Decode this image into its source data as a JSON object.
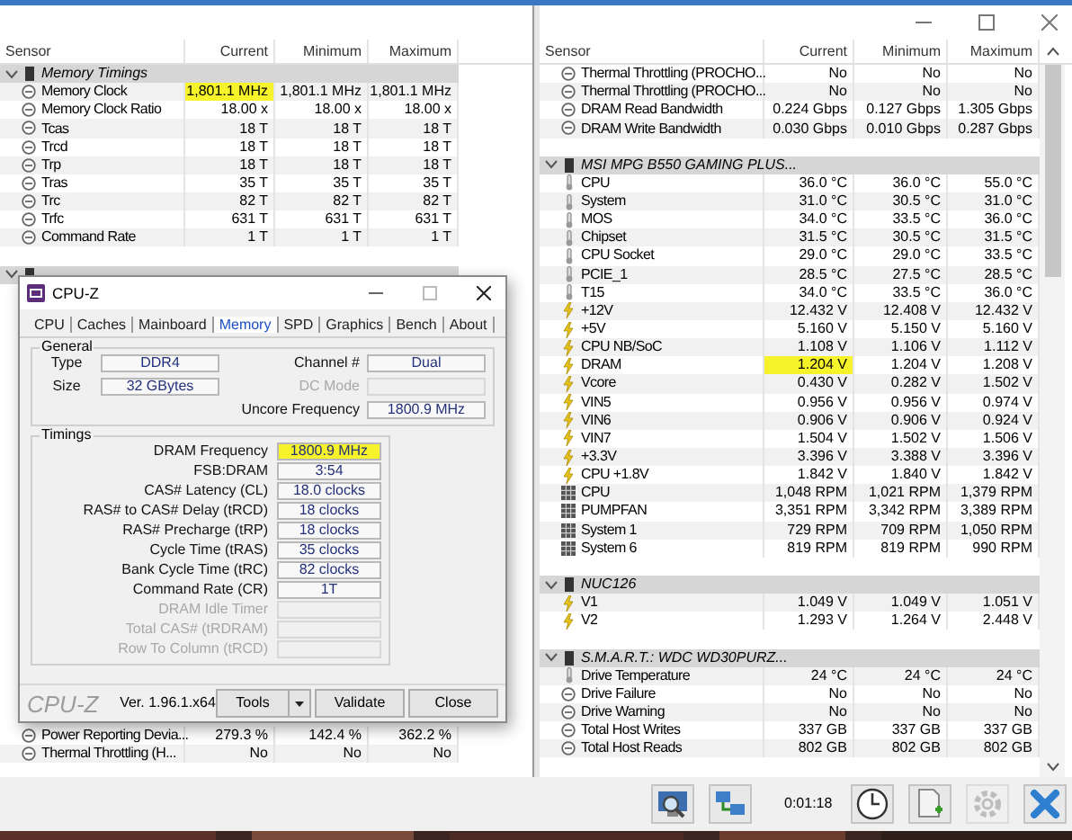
{
  "left_panel": {
    "columns": [
      "Sensor",
      "Current",
      "Minimum",
      "Maximum"
    ],
    "upper_rows": [
      {
        "kind": "group",
        "label": "Memory Timings",
        "expanded": true
      },
      {
        "kind": "status",
        "name": "Memory Clock",
        "current": "1,801.1 MHz",
        "minimum": "1,801.1 MHz",
        "maximum": "1,801.1 MHz",
        "highlighted": true
      },
      {
        "kind": "status",
        "name": "Memory Clock Ratio",
        "current": "18.00 x",
        "minimum": "18.00 x",
        "maximum": "18.00 x",
        "highlighted": false
      },
      {
        "kind": "status",
        "name": "Tcas",
        "current": "18 T",
        "minimum": "18 T",
        "maximum": "18 T",
        "highlighted": false
      },
      {
        "kind": "status",
        "name": "Trcd",
        "current": "18 T",
        "minimum": "18 T",
        "maximum": "18 T",
        "highlighted": false
      },
      {
        "kind": "status",
        "name": "Trp",
        "current": "18 T",
        "minimum": "18 T",
        "maximum": "18 T",
        "highlighted": false
      },
      {
        "kind": "status",
        "name": "Tras",
        "current": "35 T",
        "minimum": "35 T",
        "maximum": "35 T",
        "highlighted": false
      },
      {
        "kind": "status",
        "name": "Trc",
        "current": "82 T",
        "minimum": "82 T",
        "maximum": "82 T",
        "highlighted": false
      },
      {
        "kind": "status",
        "name": "Trfc",
        "current": "631 T",
        "minimum": "631 T",
        "maximum": "631 T",
        "highlighted": false
      },
      {
        "kind": "status",
        "name": "Command Rate",
        "current": "1 T",
        "minimum": "1 T",
        "maximum": "1 T",
        "highlighted": false
      },
      {
        "kind": "spacer"
      },
      {
        "kind": "group",
        "expanded": true
      }
    ],
    "lower_rows": [
      {
        "kind": "status",
        "name": "Power Reporting Devia...",
        "current": "279.3 %",
        "minimum": "142.4 %",
        "maximum": "362.2 %",
        "highlighted": false
      },
      {
        "kind": "status",
        "name": "Thermal Throttling (H...",
        "current": "No",
        "minimum": "No",
        "maximum": "No",
        "highlighted": false
      }
    ]
  },
  "right_panel": {
    "columns": [
      "Sensor",
      "Current",
      "Minimum",
      "Maximum"
    ],
    "rows": [
      {
        "kind": "status",
        "name": "Thermal Throttling (PROCHO...",
        "current": "No",
        "minimum": "No",
        "maximum": "No",
        "highlighted": false
      },
      {
        "kind": "status",
        "name": "Thermal Throttling (PROCHO...",
        "current": "No",
        "minimum": "No",
        "maximum": "No",
        "highlighted": false
      },
      {
        "kind": "status",
        "name": "DRAM Read Bandwidth",
        "current": "0.224 Gbps",
        "minimum": "0.127 Gbps",
        "maximum": "1.305 Gbps",
        "highlighted": false
      },
      {
        "kind": "status",
        "name": "DRAM Write Bandwidth",
        "current": "0.030 Gbps",
        "minimum": "0.010 Gbps",
        "maximum": "0.287 Gbps",
        "highlighted": false
      },
      {
        "kind": "spacer"
      },
      {
        "kind": "group",
        "label": "MSI MPG B550 GAMING PLUS...",
        "expanded": true
      },
      {
        "kind": "temperature",
        "name": "CPU",
        "current": "36.0 °C",
        "minimum": "36.0 °C",
        "maximum": "55.0 °C",
        "highlighted": false
      },
      {
        "kind": "temperature",
        "name": "System",
        "current": "31.0 °C",
        "minimum": "30.5 °C",
        "maximum": "31.0 °C",
        "highlighted": false
      },
      {
        "kind": "temperature",
        "name": "MOS",
        "current": "34.0 °C",
        "minimum": "33.5 °C",
        "maximum": "36.0 °C",
        "highlighted": false
      },
      {
        "kind": "temperature",
        "name": "Chipset",
        "current": "31.5 °C",
        "minimum": "30.5 °C",
        "maximum": "31.5 °C",
        "highlighted": false
      },
      {
        "kind": "temperature",
        "name": "CPU Socket",
        "current": "29.0 °C",
        "minimum": "29.0 °C",
        "maximum": "33.5 °C",
        "highlighted": false
      },
      {
        "kind": "temperature",
        "name": "PCIE_1",
        "current": "28.5 °C",
        "minimum": "27.5 °C",
        "maximum": "28.5 °C",
        "highlighted": false
      },
      {
        "kind": "temperature",
        "name": "T15",
        "current": "34.0 °C",
        "minimum": "33.5 °C",
        "maximum": "36.0 °C",
        "highlighted": false
      },
      {
        "kind": "voltage",
        "name": "+12V",
        "current": "12.432 V",
        "minimum": "12.408 V",
        "maximum": "12.432 V",
        "highlighted": false
      },
      {
        "kind": "voltage",
        "name": "+5V",
        "current": "5.160 V",
        "minimum": "5.150 V",
        "maximum": "5.160 V",
        "highlighted": false
      },
      {
        "kind": "voltage",
        "name": "CPU NB/SoC",
        "current": "1.108 V",
        "minimum": "1.106 V",
        "maximum": "1.112 V",
        "highlighted": false
      },
      {
        "kind": "voltage",
        "name": "DRAM",
        "current": "1.204 V",
        "minimum": "1.204 V",
        "maximum": "1.208 V",
        "highlighted": true
      },
      {
        "kind": "voltage",
        "name": "Vcore",
        "current": "0.430 V",
        "minimum": "0.282 V",
        "maximum": "1.502 V",
        "highlighted": false
      },
      {
        "kind": "voltage",
        "name": "VIN5",
        "current": "0.956 V",
        "minimum": "0.956 V",
        "maximum": "0.974 V",
        "highlighted": false
      },
      {
        "kind": "voltage",
        "name": "VIN6",
        "current": "0.906 V",
        "minimum": "0.906 V",
        "maximum": "0.924 V",
        "highlighted": false
      },
      {
        "kind": "voltage",
        "name": "VIN7",
        "current": "1.504 V",
        "minimum": "1.502 V",
        "maximum": "1.506 V",
        "highlighted": false
      },
      {
        "kind": "voltage",
        "name": "+3.3V",
        "current": "3.396 V",
        "minimum": "3.388 V",
        "maximum": "3.396 V",
        "highlighted": false
      },
      {
        "kind": "voltage",
        "name": "CPU +1.8V",
        "current": "1.842 V",
        "minimum": "1.840 V",
        "maximum": "1.842 V",
        "highlighted": false
      },
      {
        "kind": "fan",
        "name": "CPU",
        "current": "1,048 RPM",
        "minimum": "1,021 RPM",
        "maximum": "1,379 RPM",
        "highlighted": false
      },
      {
        "kind": "fan",
        "name": "PUMPFAN",
        "current": "3,351 RPM",
        "minimum": "3,342 RPM",
        "maximum": "3,389 RPM",
        "highlighted": false
      },
      {
        "kind": "fan",
        "name": "System 1",
        "current": "729 RPM",
        "minimum": "709 RPM",
        "maximum": "1,050 RPM",
        "highlighted": false
      },
      {
        "kind": "fan",
        "name": "System 6",
        "current": "819 RPM",
        "minimum": "819 RPM",
        "maximum": "990 RPM",
        "highlighted": false
      },
      {
        "kind": "spacer"
      },
      {
        "kind": "group",
        "label": "NUC126",
        "expanded": true
      },
      {
        "kind": "voltage",
        "name": "V1",
        "current": "1.049 V",
        "minimum": "1.049 V",
        "maximum": "1.051 V",
        "highlighted": false
      },
      {
        "kind": "voltage",
        "name": "V2",
        "current": "1.293 V",
        "minimum": "1.264 V",
        "maximum": "2.448 V",
        "highlighted": false
      },
      {
        "kind": "spacer"
      },
      {
        "kind": "group",
        "label": "S.M.A.R.T.: WDC WD30PURZ...",
        "expanded": true
      },
      {
        "kind": "temperature",
        "name": "Drive Temperature",
        "current": "24 °C",
        "minimum": "24 °C",
        "maximum": "24 °C",
        "highlighted": false
      },
      {
        "kind": "status",
        "name": "Drive Failure",
        "current": "No",
        "minimum": "No",
        "maximum": "No",
        "highlighted": false
      },
      {
        "kind": "status",
        "name": "Drive Warning",
        "current": "No",
        "minimum": "No",
        "maximum": "No",
        "highlighted": false
      },
      {
        "kind": "status",
        "name": "Total Host Writes",
        "current": "337 GB",
        "minimum": "337 GB",
        "maximum": "337 GB",
        "highlighted": false
      },
      {
        "kind": "status",
        "name": "Total Host Reads",
        "current": "802 GB",
        "minimum": "802 GB",
        "maximum": "802 GB",
        "highlighted": false
      }
    ]
  },
  "toolbar": {
    "items": [
      {
        "kind": "sensors",
        "disabled": false
      },
      {
        "kind": "network",
        "disabled": false
      },
      {
        "kind": "timer",
        "text": "0:01:18"
      },
      {
        "kind": "clock",
        "disabled": false
      },
      {
        "kind": "log",
        "disabled": false
      },
      {
        "kind": "settings",
        "disabled": true
      },
      {
        "kind": "close",
        "disabled": false
      }
    ]
  },
  "cpuz": {
    "title": "CPU-Z",
    "tabs": [
      {
        "label": "CPU",
        "selected": false
      },
      {
        "label": "Caches",
        "selected": false
      },
      {
        "label": "Mainboard",
        "selected": false
      },
      {
        "label": "Memory",
        "selected": true
      },
      {
        "label": "SPD",
        "selected": false
      },
      {
        "label": "Graphics",
        "selected": false
      },
      {
        "label": "Bench",
        "selected": false
      },
      {
        "label": "About",
        "selected": false
      }
    ],
    "general": {
      "title": "General",
      "left_fields": [
        {
          "label": "Type",
          "value": "DDR4",
          "disabled": false
        },
        {
          "label": "Size",
          "value": "32 GBytes",
          "disabled": false
        }
      ],
      "right_fields": [
        {
          "label": "Channel #",
          "value": "Dual",
          "disabled": false
        },
        {
          "label": "DC Mode",
          "disabled": true
        },
        {
          "label": "Uncore Frequency",
          "value": "1800.9 MHz",
          "disabled": false
        }
      ]
    },
    "timings": {
      "title": "Timings",
      "fields": [
        {
          "label": "DRAM Frequency",
          "value": "1800.9 MHz",
          "disabled": false,
          "highlighted": true
        },
        {
          "label": "FSB:DRAM",
          "value": "3:54",
          "disabled": false,
          "highlighted": false
        },
        {
          "label": "CAS# Latency (CL)",
          "value": "18.0 clocks",
          "disabled": false,
          "highlighted": false
        },
        {
          "label": "RAS# to CAS# Delay (tRCD)",
          "value": "18 clocks",
          "disabled": false,
          "highlighted": false
        },
        {
          "label": "RAS# Precharge (tRP)",
          "value": "18 clocks",
          "disabled": false,
          "highlighted": false
        },
        {
          "label": "Cycle Time (tRAS)",
          "value": "35 clocks",
          "disabled": false,
          "highlighted": false
        },
        {
          "label": "Bank Cycle Time (tRC)",
          "value": "82 clocks",
          "disabled": false,
          "highlighted": false
        },
        {
          "label": "Command Rate (CR)",
          "value": "1T",
          "disabled": false,
          "highlighted": false
        },
        {
          "label": "DRAM Idle Timer",
          "disabled": true,
          "highlighted": false
        },
        {
          "label": "Total CAS# (tRDRAM)",
          "disabled": true,
          "highlighted": false
        },
        {
          "label": "Row To Column (tRCD)",
          "disabled": true,
          "highlighted": false
        }
      ]
    },
    "logo": "CPU-Z",
    "version": "Ver. 1.96.1.x64",
    "buttons": [
      {
        "label": "Tools",
        "kind": "dropdown"
      },
      {
        "label": "Validate",
        "kind": "button"
      },
      {
        "label": "Close",
        "kind": "button"
      }
    ]
  }
}
